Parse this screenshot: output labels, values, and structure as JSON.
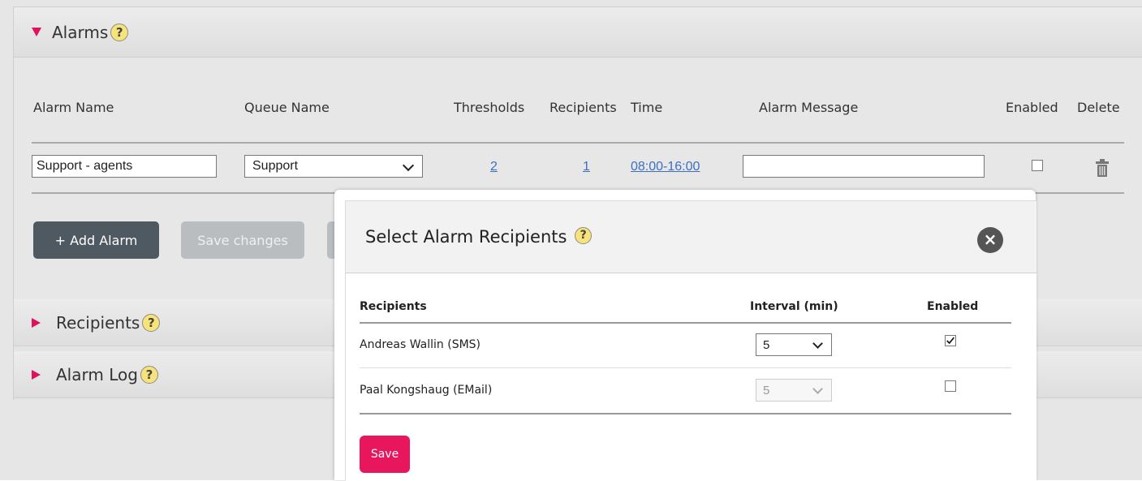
{
  "sections": {
    "alarms": {
      "title": "Alarms",
      "help": "?"
    },
    "recipients": {
      "title": "Recipients",
      "help": "?"
    },
    "alarm_log": {
      "title": "Alarm Log",
      "help": "?"
    }
  },
  "alarms_table": {
    "headers": {
      "alarm_name": "Alarm Name",
      "queue_name": "Queue Name",
      "thresholds": "Thresholds",
      "recipients": "Recipients",
      "time": "Time",
      "alarm_message": "Alarm Message",
      "enabled": "Enabled",
      "delete": "Delete"
    },
    "row": {
      "alarm_name": "Support - agents",
      "queue_name": "Support",
      "thresholds": "2",
      "recipients": "1",
      "time": "08:00-16:00",
      "alarm_message": "",
      "enabled": false
    }
  },
  "buttons": {
    "add_alarm": "+ Add Alarm",
    "save_changes": "Save changes"
  },
  "modal": {
    "title": "Select Alarm Recipients",
    "help": "?",
    "close": "×",
    "headers": {
      "recipients": "Recipients",
      "interval": "Interval (min)",
      "enabled": "Enabled"
    },
    "rows": [
      {
        "name": "Andreas Wallin (SMS)",
        "interval": "5",
        "enabled": true,
        "disabled": false
      },
      {
        "name": "Paal Kongshaug (EMail)",
        "interval": "5",
        "enabled": false,
        "disabled": true
      }
    ],
    "save": "Save"
  },
  "colors": {
    "accent": "#e0115f",
    "link": "#3c6fc0",
    "dark_button": "#4f5962",
    "disabled_button": "#b9bdc0"
  }
}
